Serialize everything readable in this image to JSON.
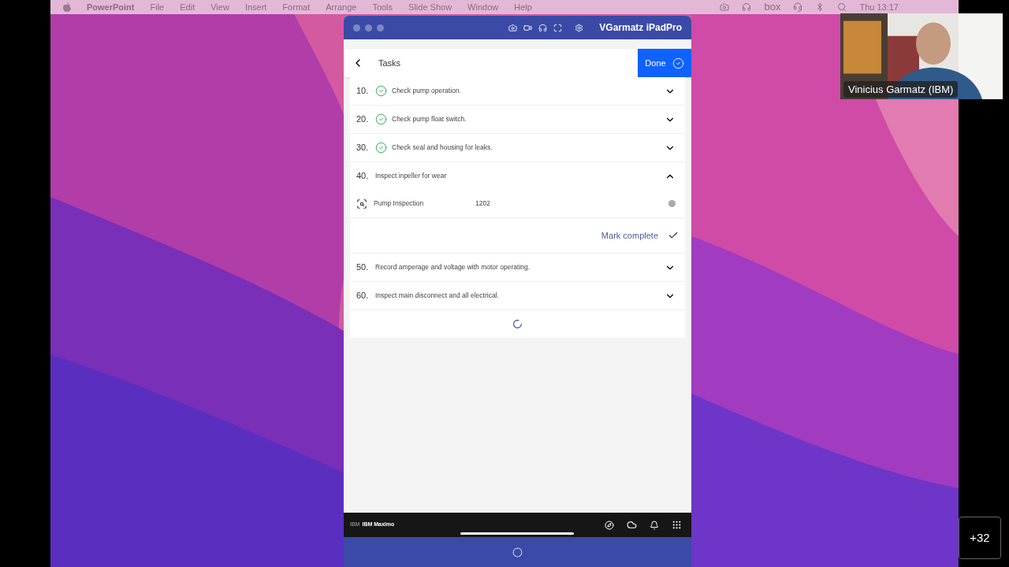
{
  "menubar": {
    "app": "PowerPoint",
    "menus": [
      "File",
      "Edit",
      "View",
      "Insert",
      "Format",
      "Arrange",
      "Tools",
      "Slide Show",
      "Window",
      "Help"
    ],
    "status_text": "box",
    "clock": "Thu 13:17"
  },
  "window": {
    "title": "VGarmatz iPadPro"
  },
  "header": {
    "title": "Tasks",
    "done_label": "Done"
  },
  "tasks": [
    {
      "number": "10.",
      "label": "Check pump operation.",
      "completed": true,
      "expanded": false
    },
    {
      "number": "20.",
      "label": "Check pump float switch.",
      "completed": true,
      "expanded": false
    },
    {
      "number": "30.",
      "label": "Check seal and housing for leaks.",
      "completed": true,
      "expanded": false
    },
    {
      "number": "40.",
      "label": "Inspect inpeller for wear",
      "completed": false,
      "expanded": true,
      "detail": {
        "name": "Pump Inspection",
        "value": "1202"
      },
      "action": "Mark complete"
    },
    {
      "number": "50.",
      "label": "Record amperage and voltage with motor operating.",
      "completed": false,
      "expanded": false
    },
    {
      "number": "60.",
      "label": "Inspect main disconnect and all electrical.",
      "completed": false,
      "expanded": false
    }
  ],
  "footer": {
    "logo": "IBM",
    "product": "IBM Maximo"
  },
  "video": {
    "name": "Vinicius Garmatz (IBM)"
  },
  "overflow_count": "+32"
}
